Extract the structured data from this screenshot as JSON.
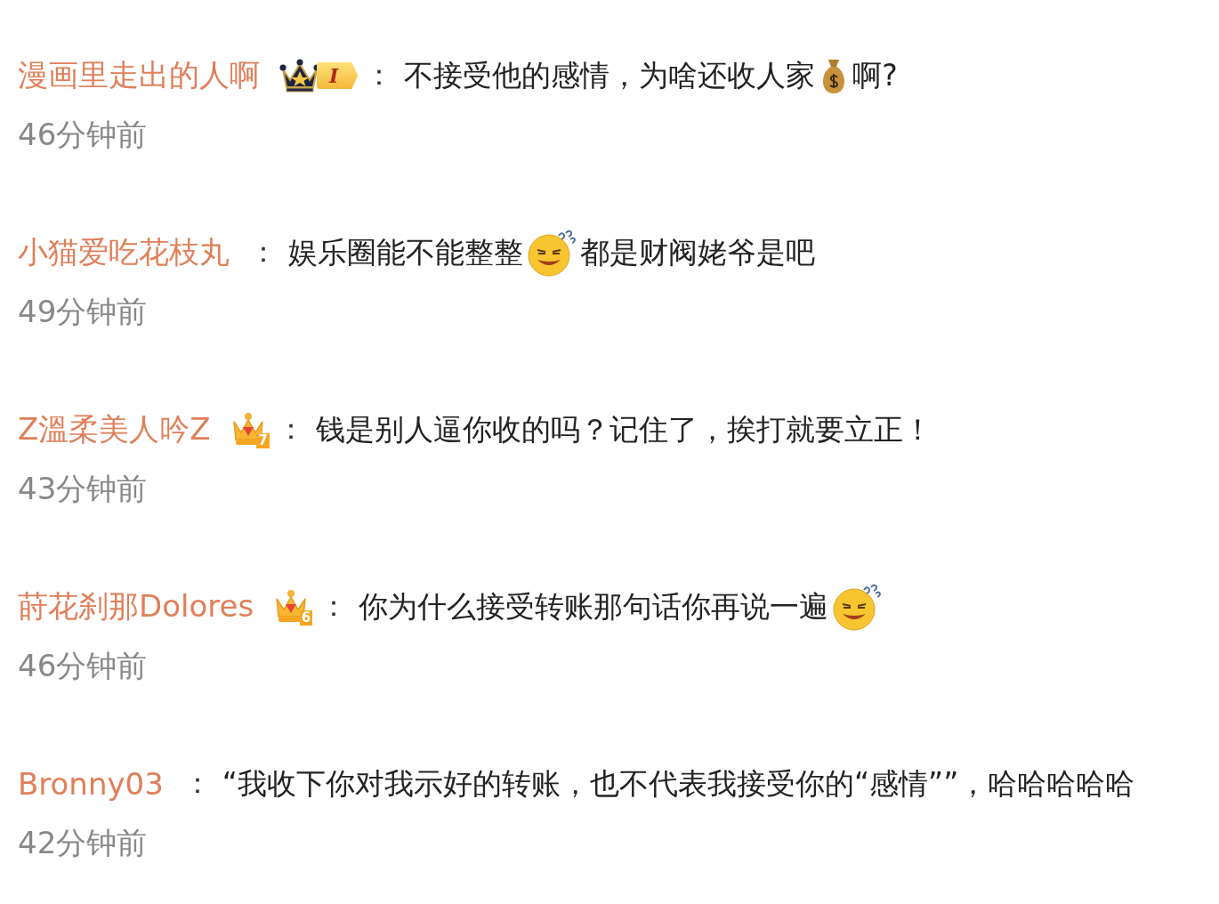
{
  "comments": [
    {
      "user": "漫画里走出的人啊",
      "badge": {
        "kind": "vip",
        "label": "I"
      },
      "separator": "：",
      "content": [
        {
          "kind": "text",
          "text": "不接受他的感情，为啥还收人家"
        },
        {
          "kind": "money_emoji"
        },
        {
          "kind": "text",
          "text": "啊?"
        }
      ],
      "time": "46分钟前"
    },
    {
      "user": "小猫爱吃花枝丸",
      "separator": "：",
      "content": [
        {
          "kind": "text",
          "text": "娱乐圈能不能整整"
        },
        {
          "kind": "grin_emoji"
        },
        {
          "kind": "text",
          "text": "都是财阀姥爷是吧"
        }
      ],
      "time": "49分钟前"
    },
    {
      "user": "Z溫柔美人吟Z",
      "badge": {
        "kind": "crown",
        "label": "7"
      },
      "separator": "：",
      "content": [
        {
          "kind": "text",
          "text": "钱是别人逼你收的吗？记住了，挨打就要立正！"
        }
      ],
      "time": "43分钟前"
    },
    {
      "user": "莳花刹那Dolores",
      "badge": {
        "kind": "crown",
        "label": "6"
      },
      "separator": "：",
      "content": [
        {
          "kind": "text",
          "text": "你为什么接受转账那句话你再说一遍"
        },
        {
          "kind": "grin_emoji"
        }
      ],
      "time": "46分钟前"
    },
    {
      "user": "Bronny03",
      "separator": "：",
      "content": [
        {
          "kind": "text",
          "text": "“我收下你对我示好的转账，也不代表我接受你的“感情””，哈哈哈哈哈"
        }
      ],
      "time": "42分钟前"
    }
  ]
}
